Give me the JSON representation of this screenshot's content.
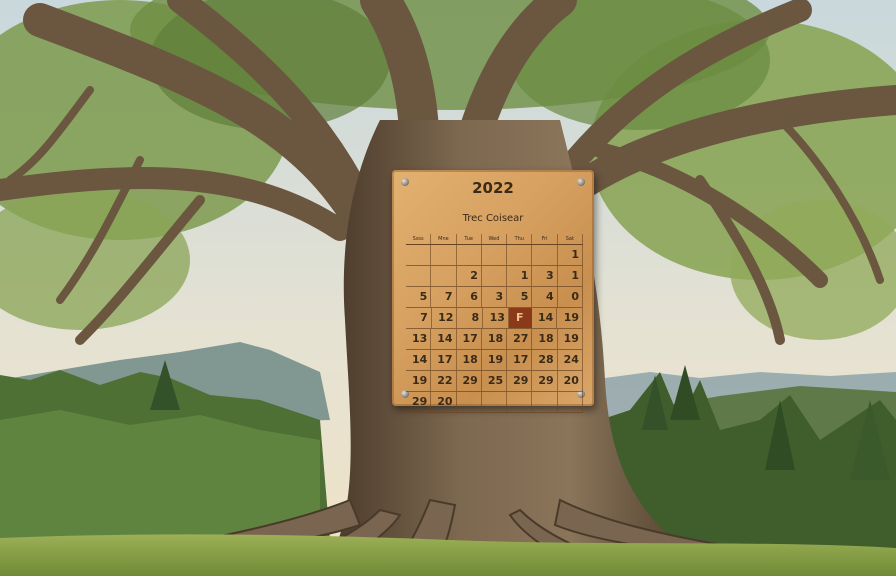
{
  "calendar": {
    "year": "2022",
    "title": "Trec Coisear",
    "weekday_headers": [
      "Ssss",
      "Mne",
      "Tue",
      "Wed",
      "Thu",
      "Fri",
      "Sat"
    ],
    "weeks": [
      [
        "",
        "",
        "",
        "",
        "",
        "",
        "1"
      ],
      [
        "",
        "",
        "2",
        "",
        "1",
        "3",
        "1"
      ],
      [
        "5",
        "7",
        "6",
        "3",
        "5",
        "4",
        "0"
      ],
      [
        "7",
        "12",
        "8",
        "13",
        "F",
        "14",
        "19"
      ],
      [
        "13",
        "14",
        "17",
        "18",
        "27",
        "18",
        "19"
      ],
      [
        "14",
        "17",
        "18",
        "19",
        "17",
        "28",
        "24"
      ],
      [
        "19",
        "22",
        "29",
        "25",
        "29",
        "29",
        "20"
      ],
      [
        "29",
        "20",
        "",
        "",
        "",
        "",
        ""
      ]
    ],
    "highlighted": "F"
  },
  "colors": {
    "sky": "#d9e3e6",
    "plaque_wood": "#d6a060",
    "trunk": "#6e5a44",
    "foliage": "#7a9a4a",
    "grass": "#8aa24a"
  }
}
